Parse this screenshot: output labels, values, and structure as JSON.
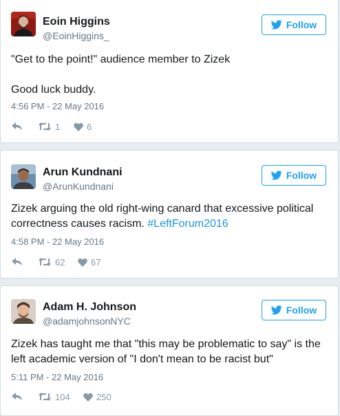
{
  "tweets": [
    {
      "name": "Eoin Higgins",
      "handle": "@EoinHiggins_",
      "follow_label": "Follow",
      "text_lines": [
        "\"Get to the point!\" audience member to Zizek",
        "",
        "Good luck buddy."
      ],
      "timestamp": "4:56 PM - 22 May 2016",
      "retweets": "1",
      "likes": "6"
    },
    {
      "name": "Arun Kundnani",
      "handle": "@ArunKundnani",
      "follow_label": "Follow",
      "text_line1": "Zizek arguing the old right-wing canard that excessive political",
      "text_line2_pre": "correctness causes racism. ",
      "hashtag": "#LeftForum2016",
      "timestamp": "4:58 PM - 22 May 2016",
      "retweets": "62",
      "likes": "67"
    },
    {
      "name": "Adam H. Johnson",
      "handle": "@adamjohnsonNYC",
      "follow_label": "Follow",
      "text_lines": [
        "Zizek has taught me that \"this may be problematic to say\" is the",
        "left academic version of \"I don't mean to be racist but\""
      ],
      "timestamp": "5:11 PM - 22 May 2016",
      "retweets": "104",
      "likes": "250"
    }
  ],
  "icons": {
    "follow_icon": "twitter-bird-icon",
    "reply_icon": "reply-icon",
    "retweet_icon": "retweet-icon",
    "like_icon": "heart-icon"
  },
  "colors": {
    "accent": "#1da1f2",
    "hashtag": "#1b95e0",
    "muted": "#657786",
    "action_gray": "#8899a6",
    "background": "#e6ecf0"
  }
}
